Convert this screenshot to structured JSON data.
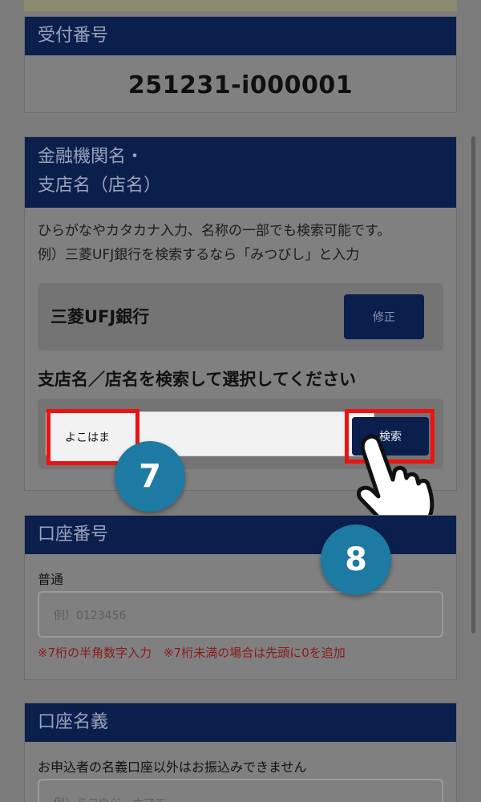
{
  "receipt": {
    "label": "受付番号",
    "number": "251231-i000001"
  },
  "bank": {
    "label_line1": "金融機関名・",
    "label_line2": "支店名（店名）",
    "hint_line1": "ひらがなやカタカナ入力、名称の一部でも検索可能です。",
    "hint_line2": "例）三菱UFJ銀行を検索するなら「みつびし」と入力",
    "selected_bank": "三菱UFJ銀行",
    "edit_label": "修正",
    "branch_label": "支店名／店名を検索して選択してください",
    "search_value": "よこはま",
    "search_button": "検索"
  },
  "steps": {
    "step7": "7",
    "step8": "8"
  },
  "account": {
    "label": "口座番号",
    "type": "普通",
    "placeholder": "例）0123456",
    "note": "※7桁の半角数字入力　※7桁未満の場合は先頭に0を追加"
  },
  "holder": {
    "label": "口座名義",
    "note": "お申込者の名義口座以外はお振込みできません",
    "placeholder": "例）ミヨウジ　ナマエ"
  },
  "colors": {
    "header": "#0b1f4d",
    "highlight": "#ee1111",
    "step_badge": "#1d7aa3"
  }
}
